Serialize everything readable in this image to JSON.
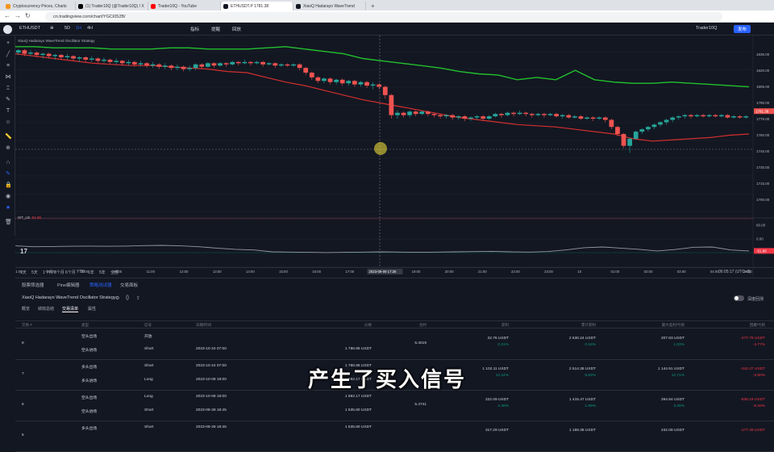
{
  "browser": {
    "tabs": [
      {
        "title": "Cryptocurrency Prices, Charts",
        "color": "#f7931a"
      },
      {
        "title": "(1) Trader10Q (@Trader10Q) / X",
        "color": "#000000"
      },
      {
        "title": "Trader10Q - YouTube",
        "color": "#ff0000"
      },
      {
        "title": "ETHUSDT.P 1781.38",
        "color": "#131722",
        "active": true
      },
      {
        "title": "XiaoQ Hadarayo WaveTrend",
        "color": "#131722"
      }
    ],
    "new_tab": "+",
    "url": "cn.tradingview.com/chart/YGCi052B/"
  },
  "tv_top": {
    "symbol": "ETHUSDT",
    "intervals": [
      "5D",
      "1H",
      "4H"
    ],
    "items": [
      "指标",
      "提醒",
      "回放"
    ],
    "layout_name": "Trader10Q",
    "publish": "发布"
  },
  "chart": {
    "legend": "XiaoQ Hadarayo WaveTrend Oscillator Strategy",
    "price_labels": [
      "1835.00",
      "1820.00",
      "1805.00",
      "1790.00",
      "1775.00",
      "1760.00",
      "1745.00",
      "1730.00",
      "1715.00",
      "1700.00"
    ],
    "current_price": "1781.38",
    "osc_legend": "WT_LB",
    "osc_value": "-51.86",
    "osc_labels": [
      "60.00",
      "0.00",
      "-60.00"
    ],
    "time_labels": [
      "21:00",
      "08:00",
      "09:00",
      "10:00",
      "11:00",
      "12:00",
      "13:00",
      "14:00",
      "15:00",
      "16:00",
      "17:00",
      "2023-09-09 17:26",
      "19:00",
      "20:00",
      "21:00",
      "22:00",
      "23:00",
      "10",
      "01:00",
      "02:00",
      "03:00",
      "04:00",
      "05:00"
    ],
    "candles_colors": {
      "up": "#26a69a",
      "down": "#ef5350"
    },
    "bands_colors": {
      "upper": "#22c02e",
      "lower": "#d32f2f",
      "osc": "#9598a1"
    },
    "chart_data": {
      "type": "candlestick",
      "candles": [
        {
          "o": 1831,
          "c": 1833,
          "h": 1834,
          "l": 1829
        },
        {
          "o": 1833,
          "c": 1830,
          "h": 1834,
          "l": 1828
        },
        {
          "o": 1830,
          "c": 1831,
          "h": 1833,
          "l": 1828
        },
        {
          "o": 1831,
          "c": 1829,
          "h": 1832,
          "l": 1827
        },
        {
          "o": 1829,
          "c": 1830,
          "h": 1831,
          "l": 1826
        },
        {
          "o": 1830,
          "c": 1828,
          "h": 1831,
          "l": 1826
        },
        {
          "o": 1828,
          "c": 1829,
          "h": 1830,
          "l": 1825
        },
        {
          "o": 1829,
          "c": 1827,
          "h": 1830,
          "l": 1825
        },
        {
          "o": 1827,
          "c": 1828,
          "h": 1830,
          "l": 1825
        },
        {
          "o": 1828,
          "c": 1826,
          "h": 1829,
          "l": 1824
        },
        {
          "o": 1826,
          "c": 1827,
          "h": 1828,
          "l": 1823
        },
        {
          "o": 1827,
          "c": 1825,
          "h": 1828,
          "l": 1823
        },
        {
          "o": 1825,
          "c": 1826,
          "h": 1828,
          "l": 1823
        },
        {
          "o": 1826,
          "c": 1824,
          "h": 1827,
          "l": 1822
        },
        {
          "o": 1824,
          "c": 1825,
          "h": 1827,
          "l": 1822
        },
        {
          "o": 1825,
          "c": 1823,
          "h": 1826,
          "l": 1821
        },
        {
          "o": 1823,
          "c": 1824,
          "h": 1826,
          "l": 1821
        },
        {
          "o": 1824,
          "c": 1822,
          "h": 1825,
          "l": 1820
        },
        {
          "o": 1822,
          "c": 1823,
          "h": 1825,
          "l": 1820
        },
        {
          "o": 1823,
          "c": 1821,
          "h": 1824,
          "l": 1819
        },
        {
          "o": 1821,
          "c": 1822,
          "h": 1824,
          "l": 1819
        },
        {
          "o": 1822,
          "c": 1820,
          "h": 1823,
          "l": 1818
        },
        {
          "o": 1820,
          "c": 1821,
          "h": 1823,
          "l": 1818
        },
        {
          "o": 1821,
          "c": 1819,
          "h": 1822,
          "l": 1817
        },
        {
          "o": 1819,
          "c": 1820,
          "h": 1822,
          "l": 1817
        },
        {
          "o": 1820,
          "c": 1818,
          "h": 1821,
          "l": 1816
        },
        {
          "o": 1818,
          "c": 1819,
          "h": 1821,
          "l": 1816
        },
        {
          "o": 1819,
          "c": 1817,
          "h": 1820,
          "l": 1815
        },
        {
          "o": 1817,
          "c": 1818,
          "h": 1820,
          "l": 1815
        },
        {
          "o": 1818,
          "c": 1821,
          "h": 1822,
          "l": 1816
        },
        {
          "o": 1821,
          "c": 1819,
          "h": 1822,
          "l": 1817
        },
        {
          "o": 1819,
          "c": 1822,
          "h": 1823,
          "l": 1818
        },
        {
          "o": 1822,
          "c": 1820,
          "h": 1823,
          "l": 1818
        },
        {
          "o": 1820,
          "c": 1822,
          "h": 1823,
          "l": 1819
        },
        {
          "o": 1822,
          "c": 1821,
          "h": 1823,
          "l": 1819
        },
        {
          "o": 1821,
          "c": 1823,
          "h": 1824,
          "l": 1820
        },
        {
          "o": 1823,
          "c": 1822,
          "h": 1824,
          "l": 1820
        },
        {
          "o": 1822,
          "c": 1823,
          "h": 1825,
          "l": 1821
        },
        {
          "o": 1823,
          "c": 1822,
          "h": 1824,
          "l": 1820
        },
        {
          "o": 1822,
          "c": 1823,
          "h": 1824,
          "l": 1821
        },
        {
          "o": 1823,
          "c": 1821,
          "h": 1824,
          "l": 1819
        },
        {
          "o": 1821,
          "c": 1822,
          "h": 1823,
          "l": 1820
        },
        {
          "o": 1822,
          "c": 1820,
          "h": 1823,
          "l": 1818
        },
        {
          "o": 1820,
          "c": 1821,
          "h": 1822,
          "l": 1819
        },
        {
          "o": 1821,
          "c": 1820,
          "h": 1822,
          "l": 1819
        },
        {
          "o": 1820,
          "c": 1821,
          "h": 1822,
          "l": 1819
        },
        {
          "o": 1821,
          "c": 1818,
          "h": 1822,
          "l": 1816
        },
        {
          "o": 1818,
          "c": 1814,
          "h": 1819,
          "l": 1812
        },
        {
          "o": 1814,
          "c": 1810,
          "h": 1815,
          "l": 1808
        },
        {
          "o": 1810,
          "c": 1807,
          "h": 1811,
          "l": 1805
        },
        {
          "o": 1807,
          "c": 1809,
          "h": 1810,
          "l": 1805
        },
        {
          "o": 1809,
          "c": 1806,
          "h": 1810,
          "l": 1804
        },
        {
          "o": 1806,
          "c": 1808,
          "h": 1809,
          "l": 1804
        },
        {
          "o": 1808,
          "c": 1805,
          "h": 1809,
          "l": 1803
        },
        {
          "o": 1805,
          "c": 1807,
          "h": 1808,
          "l": 1803
        },
        {
          "o": 1807,
          "c": 1804,
          "h": 1808,
          "l": 1802
        },
        {
          "o": 1804,
          "c": 1806,
          "h": 1807,
          "l": 1802
        },
        {
          "o": 1806,
          "c": 1803,
          "h": 1807,
          "l": 1801
        },
        {
          "o": 1803,
          "c": 1804,
          "h": 1806,
          "l": 1800
        },
        {
          "o": 1804,
          "c": 1802,
          "h": 1805,
          "l": 1800
        },
        {
          "o": 1802,
          "c": 1795,
          "h": 1803,
          "l": 1792
        },
        {
          "o": 1795,
          "c": 1778,
          "h": 1796,
          "l": 1775
        },
        {
          "o": 1778,
          "c": 1780,
          "h": 1782,
          "l": 1775
        },
        {
          "o": 1780,
          "c": 1778,
          "h": 1781,
          "l": 1776
        },
        {
          "o": 1778,
          "c": 1781,
          "h": 1782,
          "l": 1776
        },
        {
          "o": 1781,
          "c": 1779,
          "h": 1782,
          "l": 1777
        },
        {
          "o": 1779,
          "c": 1781,
          "h": 1782,
          "l": 1778
        },
        {
          "o": 1781,
          "c": 1779,
          "h": 1782,
          "l": 1777
        },
        {
          "o": 1779,
          "c": 1778,
          "h": 1780,
          "l": 1776
        },
        {
          "o": 1778,
          "c": 1777,
          "h": 1779,
          "l": 1775
        },
        {
          "o": 1777,
          "c": 1778,
          "h": 1779,
          "l": 1775
        },
        {
          "o": 1778,
          "c": 1776,
          "h": 1779,
          "l": 1774
        },
        {
          "o": 1776,
          "c": 1777,
          "h": 1778,
          "l": 1774
        },
        {
          "o": 1777,
          "c": 1775,
          "h": 1778,
          "l": 1773
        },
        {
          "o": 1775,
          "c": 1776,
          "h": 1777,
          "l": 1773
        },
        {
          "o": 1776,
          "c": 1777,
          "h": 1778,
          "l": 1774
        },
        {
          "o": 1777,
          "c": 1775,
          "h": 1778,
          "l": 1773
        },
        {
          "o": 1775,
          "c": 1777,
          "h": 1778,
          "l": 1774
        },
        {
          "o": 1777,
          "c": 1779,
          "h": 1780,
          "l": 1776
        },
        {
          "o": 1779,
          "c": 1778,
          "h": 1780,
          "l": 1776
        },
        {
          "o": 1778,
          "c": 1780,
          "h": 1781,
          "l": 1777
        },
        {
          "o": 1780,
          "c": 1779,
          "h": 1781,
          "l": 1777
        },
        {
          "o": 1779,
          "c": 1780,
          "h": 1782,
          "l": 1778
        },
        {
          "o": 1780,
          "c": 1779,
          "h": 1781,
          "l": 1777
        },
        {
          "o": 1779,
          "c": 1778,
          "h": 1780,
          "l": 1776
        },
        {
          "o": 1778,
          "c": 1779,
          "h": 1780,
          "l": 1777
        },
        {
          "o": 1779,
          "c": 1778,
          "h": 1780,
          "l": 1776
        },
        {
          "o": 1778,
          "c": 1779,
          "h": 1780,
          "l": 1777
        },
        {
          "o": 1779,
          "c": 1777,
          "h": 1780,
          "l": 1776
        },
        {
          "o": 1777,
          "c": 1778,
          "h": 1779,
          "l": 1775
        },
        {
          "o": 1778,
          "c": 1776,
          "h": 1779,
          "l": 1775
        },
        {
          "o": 1776,
          "c": 1777,
          "h": 1778,
          "l": 1775
        },
        {
          "o": 1777,
          "c": 1775,
          "h": 1778,
          "l": 1774
        },
        {
          "o": 1775,
          "c": 1776,
          "h": 1777,
          "l": 1774
        },
        {
          "o": 1776,
          "c": 1775,
          "h": 1777,
          "l": 1773
        },
        {
          "o": 1775,
          "c": 1776,
          "h": 1777,
          "l": 1774
        },
        {
          "o": 1776,
          "c": 1774,
          "h": 1777,
          "l": 1772
        },
        {
          "o": 1774,
          "c": 1768,
          "h": 1775,
          "l": 1766
        },
        {
          "o": 1768,
          "c": 1762,
          "h": 1769,
          "l": 1760
        },
        {
          "o": 1762,
          "c": 1752,
          "h": 1763,
          "l": 1750
        },
        {
          "o": 1752,
          "c": 1758,
          "h": 1759,
          "l": 1746
        },
        {
          "o": 1758,
          "c": 1764,
          "h": 1765,
          "l": 1757
        },
        {
          "o": 1764,
          "c": 1766,
          "h": 1767,
          "l": 1762
        },
        {
          "o": 1766,
          "c": 1768,
          "h": 1769,
          "l": 1764
        },
        {
          "o": 1768,
          "c": 1770,
          "h": 1771,
          "l": 1766
        },
        {
          "o": 1770,
          "c": 1772,
          "h": 1773,
          "l": 1768
        },
        {
          "o": 1772,
          "c": 1774,
          "h": 1775,
          "l": 1770
        },
        {
          "o": 1774,
          "c": 1776,
          "h": 1777,
          "l": 1772
        },
        {
          "o": 1776,
          "c": 1777,
          "h": 1778,
          "l": 1774
        },
        {
          "o": 1777,
          "c": 1778,
          "h": 1779,
          "l": 1775
        },
        {
          "o": 1778,
          "c": 1777,
          "h": 1779,
          "l": 1775
        },
        {
          "o": 1777,
          "c": 1778,
          "h": 1779,
          "l": 1776
        },
        {
          "o": 1778,
          "c": 1777,
          "h": 1779,
          "l": 1776
        },
        {
          "o": 1777,
          "c": 1778,
          "h": 1779,
          "l": 1776
        },
        {
          "o": 1778,
          "c": 1777,
          "h": 1779,
          "l": 1776
        },
        {
          "o": 1777,
          "c": 1778,
          "h": 1779,
          "l": 1776
        },
        {
          "o": 1778,
          "c": 1776,
          "h": 1779,
          "l": 1775
        },
        {
          "o": 1776,
          "c": 1777,
          "h": 1778,
          "l": 1775
        },
        {
          "o": 1777,
          "c": 1776,
          "h": 1778,
          "l": 1775
        },
        {
          "o": 1776,
          "c": 1777,
          "h": 1778,
          "l": 1775
        }
      ],
      "upper_band": [
        1836,
        1836,
        1835,
        1835,
        1835,
        1834,
        1834,
        1834,
        1835,
        1835,
        1834,
        1834,
        1834,
        1835,
        1836,
        1834,
        1832,
        1830,
        1826,
        1824,
        1822,
        1820,
        1818,
        1815,
        1813,
        1812,
        1808,
        1810,
        1808,
        1816,
        1808,
        1806,
        1805,
        1805,
        1806,
        1805,
        1804,
        1803,
        1802
      ],
      "lower_band": [
        1830,
        1828,
        1826,
        1824,
        1822,
        1821,
        1820,
        1820,
        1819,
        1818,
        1817,
        1815,
        1814,
        1810,
        1806,
        1803,
        1799,
        1795,
        1791,
        1788,
        1785,
        1782,
        1779,
        1776,
        1774,
        1772,
        1770,
        1769,
        1768,
        1766,
        1764,
        1762,
        1758,
        1756,
        1757,
        1758,
        1759,
        1761,
        1762
      ],
      "oscillator": [
        -30,
        -34,
        -33,
        -32,
        -31,
        -32,
        -31,
        -29,
        -28,
        -30,
        -34,
        -40,
        -45,
        -48,
        -56,
        -57,
        -58,
        -59,
        -58,
        -57,
        -56,
        -57,
        -58,
        -57,
        -56,
        -55,
        -54,
        -56,
        -57,
        -55,
        -48,
        -38,
        -35,
        -40,
        -45,
        -52,
        -46,
        -36,
        -35,
        -48,
        -52
      ],
      "ylim": [
        1695,
        1840
      ],
      "osc_ylim": [
        -70,
        70
      ]
    }
  },
  "bottom_bar": {
    "ranges": [
      "1天",
      "5天",
      "1个月",
      "3个月",
      "6个月",
      "YTD",
      "1年",
      "5年",
      "全部"
    ],
    "time": "06:05:17 (UTC+8)"
  },
  "panel": {
    "tabs": [
      "股票筛选器",
      "Pine编辑器",
      "策略测试器",
      "交易面板"
    ],
    "strategy_name": "XiaoQ Hadarayo WaveTrend Oscillator Strategy",
    "subtabs": [
      "概览",
      "绩效总结",
      "交易清单",
      "属性"
    ],
    "toggle_label": "深度回测",
    "headers": [
      "交易 #",
      "类型",
      "信号",
      "日期/时间",
      "价格",
      "合约",
      "获利",
      "累计获利",
      "最大盈利/亏损",
      "回撤/亏损"
    ],
    "rows": [
      {
        "no": "8",
        "a_type": "空头出场",
        "a_sig": "开放",
        "a_date": "",
        "a_price": "",
        "b_type": "空头进场",
        "b_sig": "Short",
        "b_date": "2023-10-24 07:00",
        "b_price": "1 786.96 USDT",
        "qty": "5.4019",
        "profit": "22.76 USDT",
        "profit_pct": "0.21%",
        "cum": "2 530.24 USDT",
        "cum_pct": "0.18%",
        "run": "207.83 USDT",
        "run_pct": "1.03%",
        "dd": "-477.79 USDT",
        "dd_pct": "-4.77%"
      },
      {
        "no": "7",
        "a_type": "多头出场",
        "a_sig": "Short",
        "a_date": "2023-10-24 07:00",
        "a_price": "1 786.96 USDT",
        "b_type": "多头进场",
        "b_sig": "Long",
        "b_date": "2023-10-09 19:00",
        "b_price": "1 592.17 USDT",
        "qty": "",
        "profit": "1 102.11 USDT",
        "profit_pct": "12.24%",
        "cum": "2 514.38 USDT",
        "cum_pct": "9.63%",
        "run": "1 144.91 USDT",
        "run_pct": "12.71%",
        "dd": "-342.47 USDT",
        "dd_pct": "-3.80%"
      },
      {
        "no": "6",
        "a_type": "空头出场",
        "a_sig": "Long",
        "a_date": "2023-10-09 18:00",
        "a_price": "1 592.17 USDT",
        "b_type": "空头进场",
        "b_sig": "Short",
        "b_date": "2023-09-28 18:45",
        "b_price": "1 635.80 USDT",
        "qty": "5.4741",
        "profit": "222.09 USDT",
        "profit_pct": "2.48%",
        "cum": "1 415.47 USDT",
        "cum_pct": "1.99%",
        "run": "294.84 USDT",
        "run_pct": "3.29%",
        "dd": "-836.19 USDT",
        "dd_pct": "-9.33%"
      },
      {
        "no": "5",
        "a_type": "多头出场",
        "a_sig": "Short",
        "a_date": "2023-09-28 18:45",
        "a_price": "1 635.80 USDT",
        "b_type": "",
        "b_sig": "",
        "b_date": "",
        "b_price": "",
        "qty": "",
        "profit": "317.29 USDT",
        "profit_pct": "",
        "cum": "1 189.38 USDT",
        "cum_pct": "",
        "run": "242.08 USDT",
        "run_pct": "",
        "dd": "-177.39 USDT",
        "dd_pct": ""
      }
    ]
  },
  "subtitle": "产生了买入信号"
}
